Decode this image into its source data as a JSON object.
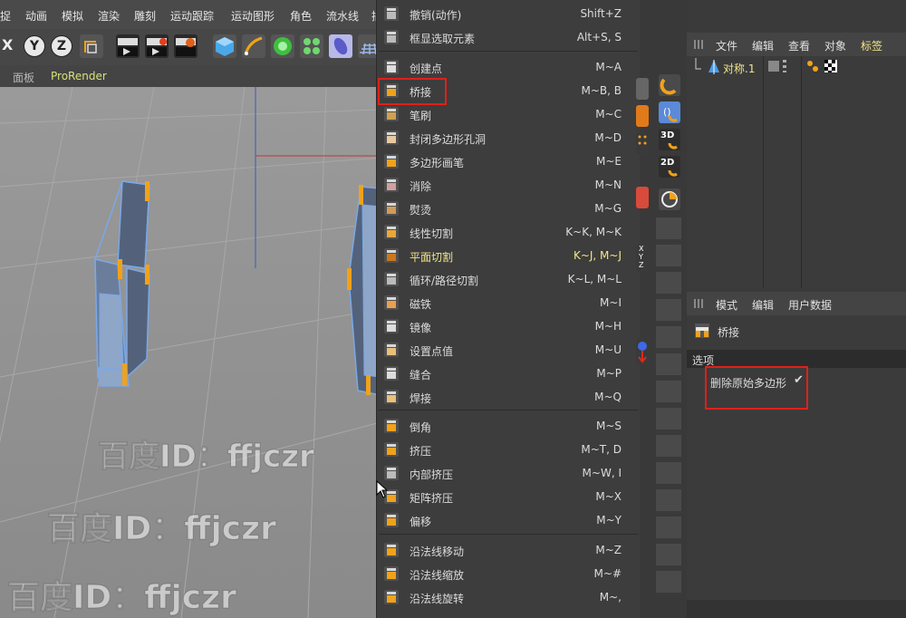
{
  "menubar": {
    "items": [
      "捉",
      "动画",
      "模拟",
      "渲染",
      "雕刻",
      "运动跟踪",
      "运动图形",
      "角色",
      "流水线",
      "插"
    ]
  },
  "toolbar": {
    "x_label": "X",
    "y_label": "Y",
    "z_label": "Z"
  },
  "viewport_header": {
    "panel_label": "面板",
    "prorender_label": "ProRender"
  },
  "watermarks": [
    "百度ID：ffjczr",
    "百度ID：ffjczr",
    "百度ID：ffjczr"
  ],
  "menu": {
    "items": [
      {
        "label": "撤销(动作)",
        "shortcut": "Shift+Z",
        "icon": "undo-icon"
      },
      {
        "label": "框显选取元素",
        "shortcut": "Alt+S, S",
        "icon": "frame-selection-icon"
      },
      {
        "label": "创建点",
        "shortcut": "M~A",
        "icon": "create-point-icon"
      },
      {
        "label": "桥接",
        "shortcut": "M~B, B",
        "icon": "bridge-icon"
      },
      {
        "label": "笔刷",
        "shortcut": "M~C",
        "icon": "brush-icon"
      },
      {
        "label": "封闭多边形孔洞",
        "shortcut": "M~D",
        "icon": "close-polygon-hole-icon"
      },
      {
        "label": "多边形画笔",
        "shortcut": "M~E",
        "icon": "polygon-pen-icon"
      },
      {
        "label": "消除",
        "shortcut": "M~N",
        "icon": "dissolve-icon"
      },
      {
        "label": "熨烫",
        "shortcut": "M~G",
        "icon": "iron-icon"
      },
      {
        "label": "线性切割",
        "shortcut": "K~K, M~K",
        "icon": "line-cut-icon"
      },
      {
        "label": "平面切割",
        "shortcut": "K~J, M~J",
        "icon": "plane-cut-icon"
      },
      {
        "label": "循环/路径切割",
        "shortcut": "K~L, M~L",
        "icon": "loop-cut-icon"
      },
      {
        "label": "磁铁",
        "shortcut": "M~I",
        "icon": "magnet-icon"
      },
      {
        "label": "镜像",
        "shortcut": "M~H",
        "icon": "mirror-icon"
      },
      {
        "label": "设置点值",
        "shortcut": "M~U",
        "icon": "set-point-value-icon"
      },
      {
        "label": "缝合",
        "shortcut": "M~P",
        "icon": "stitch-icon"
      },
      {
        "label": "焊接",
        "shortcut": "M~Q",
        "icon": "weld-icon"
      },
      {
        "label": "倒角",
        "shortcut": "M~S",
        "icon": "bevel-icon"
      },
      {
        "label": "挤压",
        "shortcut": "M~T, D",
        "icon": "extrude-icon"
      },
      {
        "label": "内部挤压",
        "shortcut": "M~W, I",
        "icon": "extrude-inner-icon"
      },
      {
        "label": "矩阵挤压",
        "shortcut": "M~X",
        "icon": "matrix-extrude-icon"
      },
      {
        "label": "偏移",
        "shortcut": "M~Y",
        "icon": "offset-icon"
      },
      {
        "label": "沿法线移动",
        "shortcut": "M~Z",
        "icon": "normal-move-icon"
      },
      {
        "label": "沿法线缩放",
        "shortcut": "M~#",
        "icon": "normal-scale-icon"
      },
      {
        "label": "沿法线旋转",
        "shortcut": "M~,",
        "icon": "normal-rotate-icon"
      }
    ]
  },
  "palette": {
    "label_3d": "3D",
    "label_2d": "2D",
    "label_xyz": "XYZ"
  },
  "object_manager": {
    "menu": [
      "文件",
      "编辑",
      "查看",
      "对象",
      "标签"
    ],
    "object_name": "对称.1"
  },
  "attribute_manager": {
    "menu": [
      "模式",
      "编辑",
      "用户数据"
    ],
    "tool_name": "桥接",
    "section_label": "选项",
    "option_label": "删除原始多边形",
    "option_check": "✔"
  },
  "colors": {
    "accent_yellow": "#f2e58a",
    "highlight_red": "#e0201a",
    "orange": "#f0a21a",
    "prorender_green": "#d6e27a"
  }
}
